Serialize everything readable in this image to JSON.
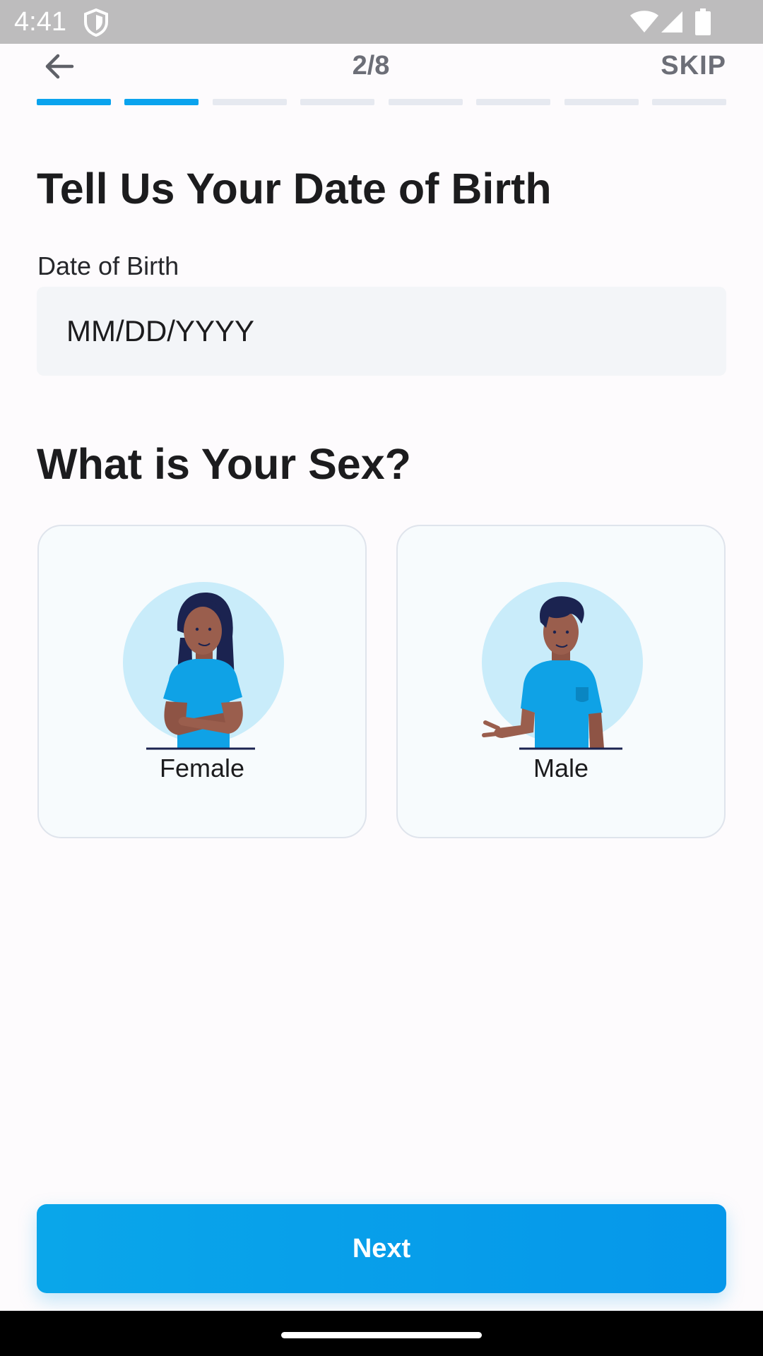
{
  "status_bar": {
    "time": "4:41",
    "icons": [
      "shield-icon",
      "wifi-icon",
      "signal-icon",
      "battery-icon"
    ]
  },
  "header": {
    "back_icon": "arrow-left-icon",
    "step": "2/8",
    "skip_label": "SKIP"
  },
  "progress": {
    "total_steps": 8,
    "completed_steps": 2,
    "active_color": "#0aa3ee",
    "inactive_color": "#e6e9f0"
  },
  "dob": {
    "heading": "Tell Us Your Date of Birth",
    "label": "Date of Birth",
    "placeholder": "MM/DD/YYYY",
    "value": ""
  },
  "sex": {
    "heading": "What is Your Sex?",
    "options": [
      {
        "label": "Female",
        "illustration": "female-avatar-illustration"
      },
      {
        "label": "Male",
        "illustration": "male-avatar-illustration"
      }
    ]
  },
  "next_label": "Next",
  "colors": {
    "accent": "#0aa6ea",
    "card_background": "#f7fbfd",
    "input_background": "#f3f5f8"
  }
}
